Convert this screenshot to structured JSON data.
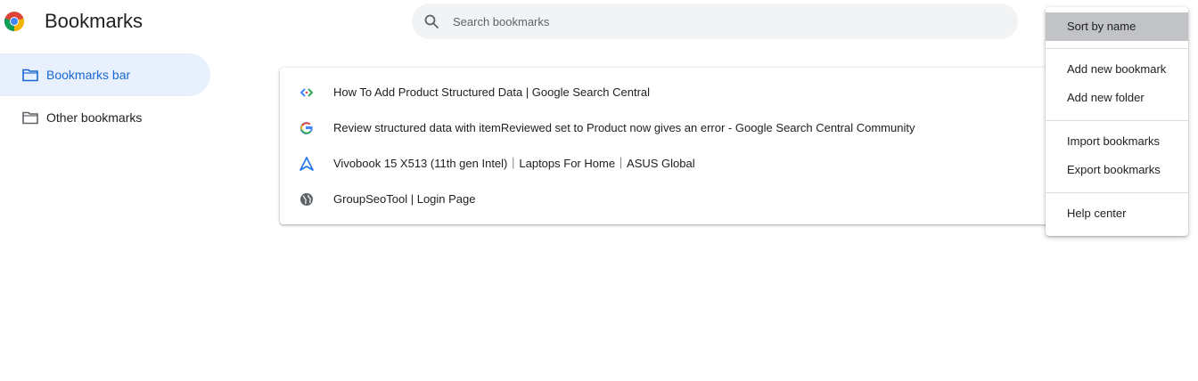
{
  "app": {
    "title": "Bookmarks",
    "logo_icon": "chrome-logo-icon"
  },
  "search": {
    "placeholder": "Search bookmarks",
    "value": "",
    "icon": "search-icon"
  },
  "sidebar": {
    "items": [
      {
        "label": "Bookmarks bar",
        "icon": "folder-icon",
        "selected": true
      },
      {
        "label": "Other bookmarks",
        "icon": "folder-icon",
        "selected": false
      }
    ]
  },
  "bookmarks": [
    {
      "title": "How To Add Product Structured Data | Google Search Central",
      "icon": "code-brackets-icon"
    },
    {
      "title": "Review structured data with itemReviewed set to Product now gives an error - Google Search Central Community",
      "icon": "google-g-icon"
    },
    {
      "title": "Vivobook 15 X513 (11th gen Intel)｜Laptops For Home｜ASUS Global",
      "icon": "asus-logo-icon"
    },
    {
      "title": "GroupSeoTool | Login Page",
      "icon": "globe-icon"
    }
  ],
  "menu": {
    "items": [
      {
        "label": "Sort by name",
        "highlighted": true
      },
      {
        "label": "Add new bookmark"
      },
      {
        "label": "Add new folder"
      },
      {
        "label": "Import bookmarks"
      },
      {
        "label": "Export bookmarks"
      },
      {
        "label": "Help center"
      }
    ]
  },
  "colors": {
    "accent": "#1967d2",
    "selected_bg": "#e8f0fe",
    "search_bg": "#f1f3f4",
    "menu_highlight": "#c1c3c6"
  }
}
